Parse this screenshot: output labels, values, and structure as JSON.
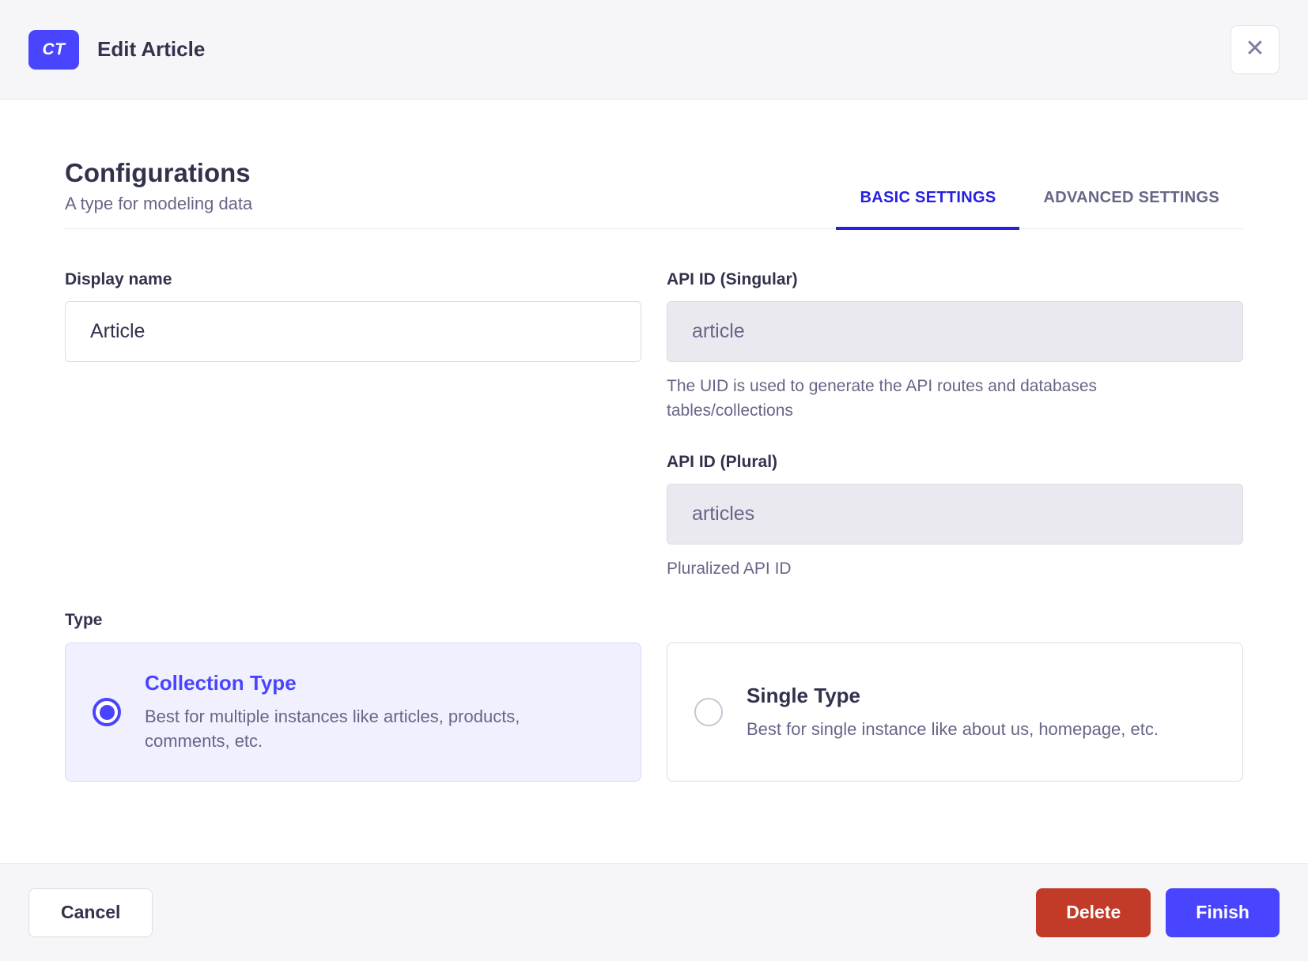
{
  "header": {
    "badge": "CT",
    "title": "Edit Article"
  },
  "icons": {
    "close": "✕"
  },
  "section": {
    "title": "Configurations",
    "subtitle": "A type for modeling data"
  },
  "tabs": [
    {
      "label": "BASIC SETTINGS",
      "active": true
    },
    {
      "label": "ADVANCED SETTINGS",
      "active": false
    }
  ],
  "form": {
    "display_name": {
      "label": "Display name",
      "value": "Article"
    },
    "api_id_singular": {
      "label": "API ID (Singular)",
      "value": "article",
      "helper": "The UID is used to generate the API routes and databases tables/collections"
    },
    "api_id_plural": {
      "label": "API ID (Plural)",
      "value": "articles",
      "helper": "Pluralized API ID"
    },
    "type": {
      "label": "Type",
      "options": [
        {
          "title": "Collection Type",
          "description": "Best for multiple instances like articles, products, comments, etc.",
          "selected": true
        },
        {
          "title": "Single Type",
          "description": "Best for single instance like about us, homepage, etc.",
          "selected": false
        }
      ]
    }
  },
  "footer": {
    "cancel_label": "Cancel",
    "delete_label": "Delete",
    "finish_label": "Finish"
  },
  "colors": {
    "primary": "#4945ff",
    "tab_active": "#271fe0",
    "danger": "#c23a28",
    "selected_card_bg": "#f0f0ff",
    "text_dark": "#32324d",
    "text_muted": "#666687",
    "chrome_bg": "#f6f6f9"
  }
}
